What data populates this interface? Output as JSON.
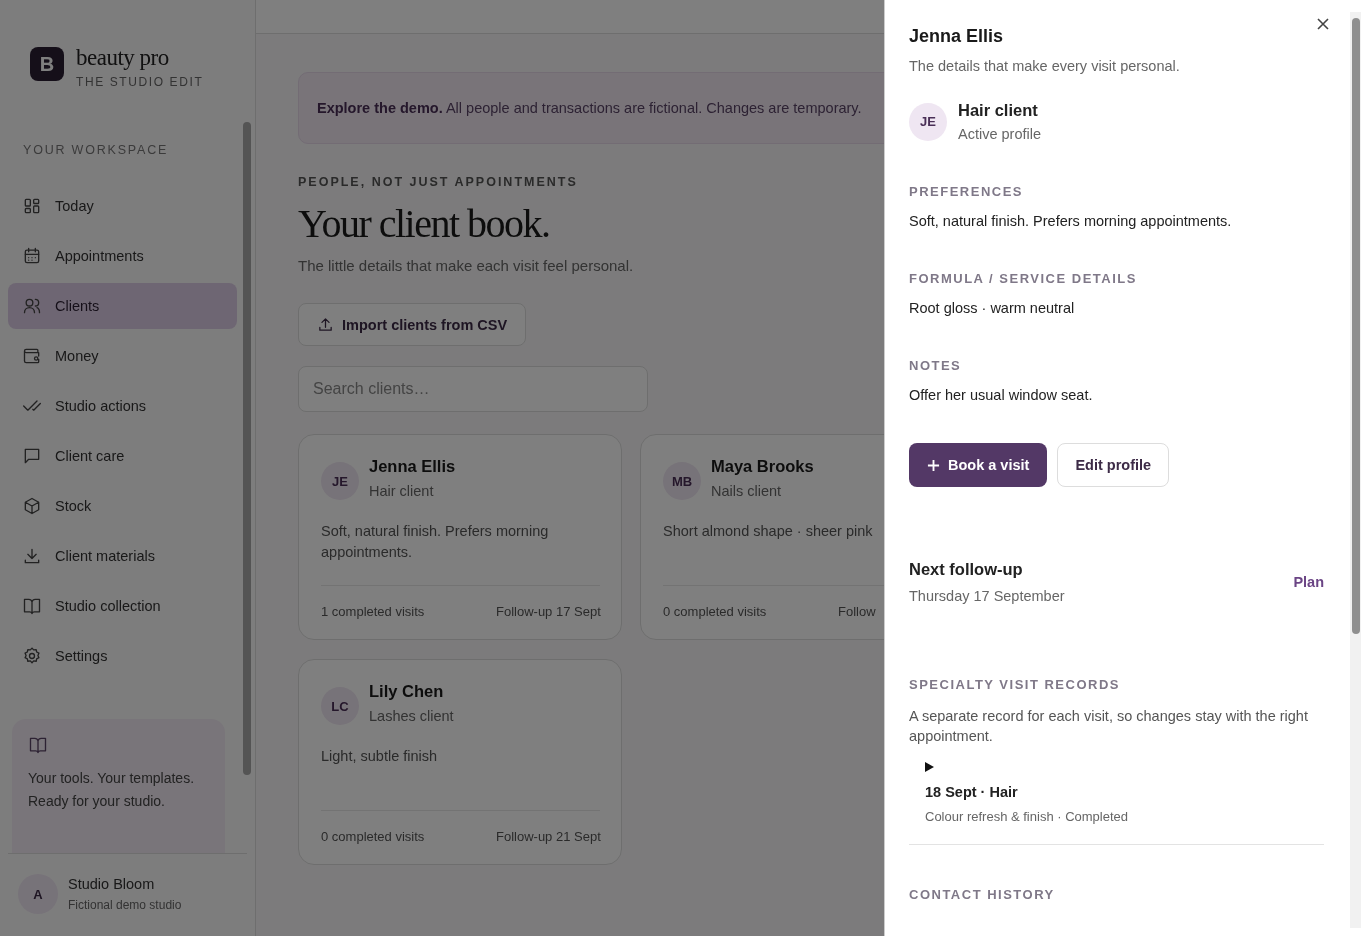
{
  "sidebar": {
    "brand": {
      "logo_letter": "B",
      "name": "beauty pro",
      "tagline": "THE STUDIO EDIT"
    },
    "section_label": "YOUR WORKSPACE",
    "items": [
      {
        "label": "Today",
        "kind": "grid",
        "selected": false
      },
      {
        "label": "Appointments",
        "kind": "calendar",
        "selected": false
      },
      {
        "label": "Clients",
        "kind": "people",
        "selected": true
      },
      {
        "label": "Money",
        "kind": "wallet",
        "selected": false
      },
      {
        "label": "Studio actions",
        "kind": "checks",
        "selected": false
      },
      {
        "label": "Client care",
        "kind": "chat",
        "selected": false
      },
      {
        "label": "Stock",
        "kind": "box",
        "selected": false
      },
      {
        "label": "Client materials",
        "kind": "download",
        "selected": false
      },
      {
        "label": "Studio collection",
        "kind": "book",
        "selected": false
      },
      {
        "label": "Settings",
        "kind": "gear",
        "selected": false
      }
    ],
    "promo": {
      "text": "Your tools. Your templates. Ready for your studio."
    },
    "account": {
      "initial": "A",
      "name": "Studio Bloom",
      "subtitle": "Fictional demo studio"
    }
  },
  "main": {
    "banner": "**Explore the demo.** All people and transactions are fictional. Changes are temporary.",
    "eyebrow": "PEOPLE, NOT JUST APPOINTMENTS",
    "title": "Your client book.",
    "subtitle": "The little details that make each visit feel personal.",
    "import_button": "Import clients from CSV",
    "search": {
      "placeholder": "Search clients…"
    },
    "clients": [
      {
        "initials": "JE",
        "name": "Jenna Ellis",
        "type": "Hair client",
        "note": "Soft, natural finish. Prefers morning appointments.",
        "visits": "1 completed visits",
        "follow_up": "Follow-up 17 Sept"
      },
      {
        "initials": "MB",
        "name": "Maya Brooks",
        "type": "Nails client",
        "note": "Short almond shape · sheer pink",
        "visits": "0 completed visits",
        "follow_up": "Follow"
      },
      {
        "initials": "LC",
        "name": "Lily Chen",
        "type": "Lashes client",
        "note": "Light, subtle finish",
        "visits": "0 completed visits",
        "follow_up": "Follow-up 21 Sept"
      }
    ]
  },
  "drawer": {
    "title": "Jenna Ellis",
    "subtitle": "The details that make every visit personal.",
    "profile": {
      "initials": "JE",
      "title": "Hair client",
      "status": "Active profile"
    },
    "sections": [
      {
        "label": "PREFERENCES",
        "text": "Soft, natural finish. Prefers morning appointments."
      },
      {
        "label": "FORMULA / SERVICE DETAILS",
        "text": "Root gloss · warm neutral"
      },
      {
        "label": "NOTES",
        "text": "Offer her usual window seat."
      }
    ],
    "primary_button": "Book a visit",
    "secondary_button": "Edit profile",
    "follow_up": {
      "title": "Next follow-up",
      "date": "Thursday 17 September",
      "action": "Plan"
    },
    "records": {
      "label": "SPECIALTY VISIT RECORDS",
      "description": "A separate record for each visit, so changes stay with the right appointment.",
      "items": [
        {
          "expanded": false,
          "title": "18 Sept · Hair",
          "detail": "Colour refresh & finish · Completed"
        }
      ]
    },
    "contact_history": {
      "label": "CONTACT HISTORY"
    }
  }
}
